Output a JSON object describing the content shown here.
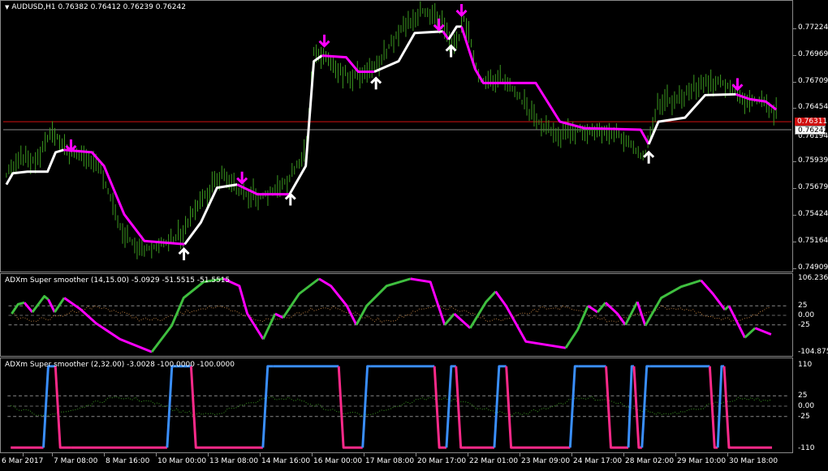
{
  "main": {
    "title": "AUDUSD,H1  0.76382 0.76412 0.76239 0.76242",
    "price_ticks": [
      "0.77224",
      "0.76969",
      "0.76709",
      "0.76454",
      "0.75939",
      "0.75679",
      "0.75424",
      "0.75164",
      "0.74909"
    ],
    "ask_line_label": "0.76311",
    "bid_label": "0.76242",
    "partial_label": "0.76194"
  },
  "ind1": {
    "title": "ADXm Super smoother (14,15.00) -5.0929 -51.5515 -51.5515",
    "ticks": [
      "106.2362",
      "25",
      "0.00",
      "-25",
      "-104.8756"
    ]
  },
  "ind2": {
    "title": "ADXm Super smoother (2,32.00) -3.0028 -100.0000 -100.0000",
    "ticks": [
      "110",
      "25",
      "0.00",
      "-25",
      "-110"
    ]
  },
  "time_axis": [
    "6 Mar 2017",
    "7 Mar 08:00",
    "8 Mar 16:00",
    "10 Mar 00:00",
    "13 Mar 08:00",
    "14 Mar 16:00",
    "16 Mar 00:00",
    "17 Mar 08:00",
    "20 Mar 17:00",
    "22 Mar 01:00",
    "23 Mar 09:00",
    "24 Mar 17:00",
    "28 Mar 02:00",
    "29 Mar 10:00",
    "30 Mar 18:00"
  ],
  "colors": {
    "bars": "#3c9a20",
    "trend_up": "#ffffff",
    "trend_down": "#ff00ff",
    "adx_up": "#3fbf3f",
    "adx_down": "#ff00ff",
    "fast_up": "#3a8fff",
    "fast_down": "#ff2a8a",
    "ask_line": "#d01010",
    "bid_line": "#8a8a8a"
  }
}
